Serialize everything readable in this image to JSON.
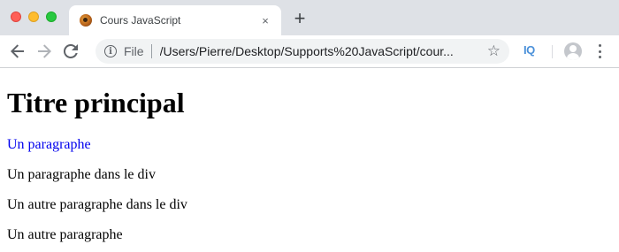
{
  "browser": {
    "tab": {
      "title": "Cours JavaScript",
      "close_icon": "×"
    },
    "new_tab_label": "+",
    "address": {
      "scheme_label": "File",
      "url": "/Users/Pierre/Desktop/Supports%20JavaScript/cour...",
      "star_icon": "☆"
    },
    "extension_label": "IQ",
    "colors": {
      "tab_strip": "#dee1e6",
      "omnibox": "#f1f3f4",
      "extension": "#4a90d9"
    }
  },
  "page": {
    "heading": "Titre principal",
    "paragraphs": [
      {
        "text": "Un paragraphe",
        "color": "#0000ee"
      },
      {
        "text": "Un paragraphe dans le div",
        "color": "#000000"
      },
      {
        "text": "Un autre paragraphe dans le div",
        "color": "#000000"
      },
      {
        "text": "Un autre paragraphe",
        "color": "#000000"
      }
    ]
  }
}
